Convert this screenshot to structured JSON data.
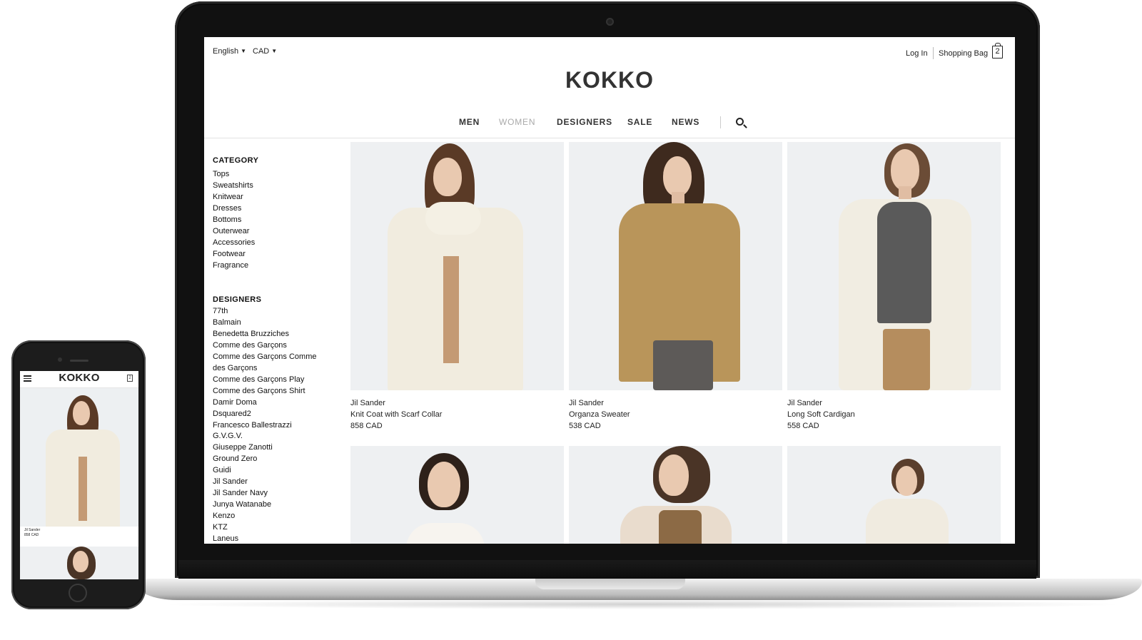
{
  "header": {
    "language": "English",
    "currency": "CAD",
    "login_label": "Log In",
    "bag_label": "Shopping Bag",
    "bag_count": "2",
    "logo": "KOKKO"
  },
  "nav": {
    "items": [
      {
        "label": "MEN"
      },
      {
        "label": "WOMEN",
        "state": "muted"
      },
      {
        "label": "DESIGNERS"
      },
      {
        "label": "SALE"
      },
      {
        "label": "NEWS"
      }
    ]
  },
  "sidebar": {
    "category_title": "CATEGORY",
    "categories": [
      "Tops",
      "Sweatshirts",
      "Knitwear",
      "Dresses",
      "Bottoms",
      "Outerwear",
      "Accessories",
      "Footwear",
      "Fragrance"
    ],
    "designers_title": "DESIGNERS",
    "designers": [
      "77th",
      "Balmain",
      "Benedetta Bruzziches",
      "Comme des Garçons",
      "Comme des Garçons Comme des Garçons",
      "Comme des Garçons Play",
      "Comme des Garçons Shirt",
      "Damir Doma",
      "Dsquared2",
      "Francesco Ballestrazzi",
      "G.V.G.V.",
      "Giuseppe Zanotti",
      "Ground Zero",
      "Guidi",
      "Jil Sander",
      "Jil Sander Navy",
      "Junya Watanabe",
      "Kenzo",
      "KTZ",
      "Laneus"
    ]
  },
  "products": [
    {
      "brand": "Jil Sander",
      "name": "Knit Coat with Scarf Collar",
      "price": "858 CAD"
    },
    {
      "brand": "Jil Sander",
      "name": "Organza Sweater",
      "price": "538 CAD"
    },
    {
      "brand": "Jil Sander",
      "name": "Long Soft Cardigan",
      "price": "558 CAD"
    }
  ],
  "mobile": {
    "logo": "KOKKO",
    "bag_count": "2",
    "brand": "Jil Sander",
    "price": "858 CAD"
  },
  "colors": {
    "accent_text": "#222222",
    "muted_nav": "#aaaaaa",
    "image_bg": "#eef0f2"
  }
}
